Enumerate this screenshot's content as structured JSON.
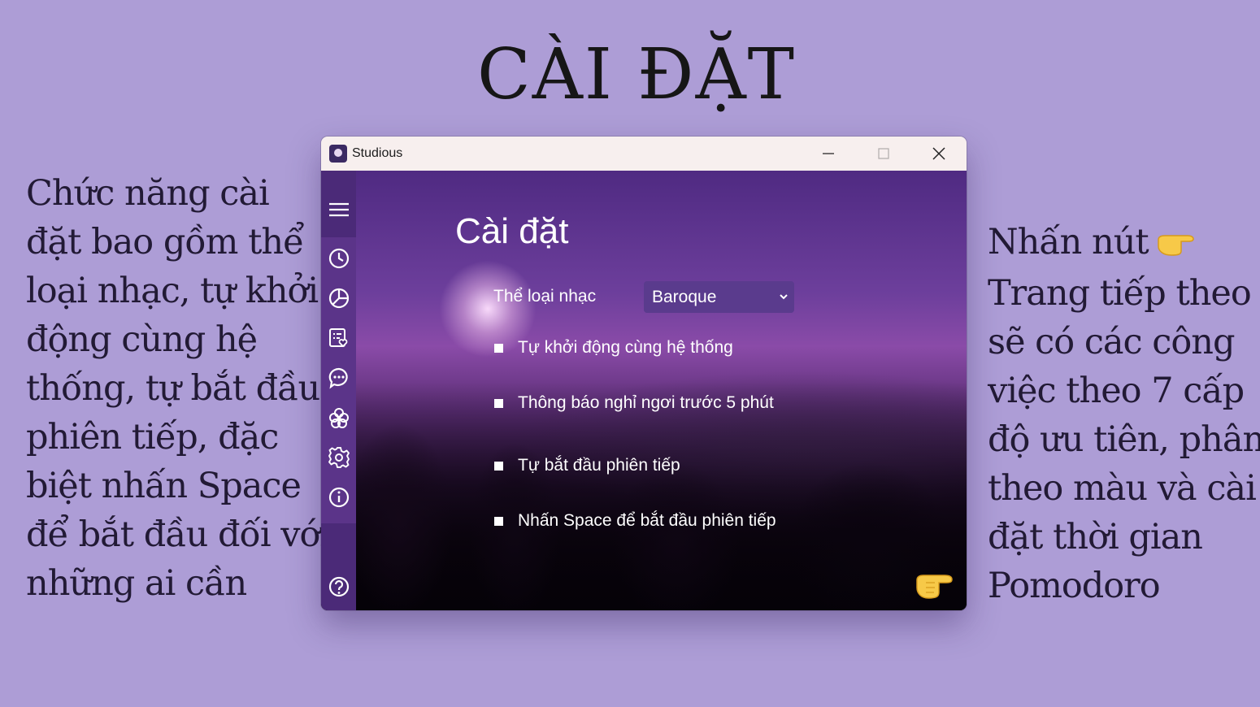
{
  "slide": {
    "title": "CÀI ĐẶT",
    "left_lines": [
      "Chức năng cài",
      "đặt bao gồm thể",
      "loại nhạc, tự khởi",
      "động cùng hệ",
      "thống, tự bắt đầu",
      "phiên tiếp, đặc",
      "biệt nhấn Space",
      "để bắt đầu đối với",
      "những ai cần"
    ],
    "right_lines": [
      "Nhấn nút",
      "Trang tiếp theo",
      "sẽ có các công",
      "việc theo 7 cấp",
      "độ ưu tiên, phân",
      "theo màu và cài",
      "đặt thời gian",
      "Pomodoro"
    ]
  },
  "window": {
    "app_name": "Studious",
    "heading": "Cài đặt",
    "music_label": "Thể loại nhạc",
    "music_selected": "Baroque",
    "options": [
      "Tự khởi động cùng hệ thống",
      "Thông báo nghỉ ngơi trước 5 phút",
      "Tự bắt đầu phiên tiếp",
      "Nhấn Space để bắt đầu phiên tiếp"
    ],
    "sidebar_icons": [
      "menu-icon",
      "clock-icon",
      "pie-chart-icon",
      "task-list-icon",
      "chat-icon",
      "flower-icon",
      "gear-icon",
      "info-icon",
      "help-icon"
    ]
  },
  "colors": {
    "slide_background": "#ad9dd6",
    "sidebar": "#4b2a78",
    "titlebar": "#f7efee",
    "select_background": "#5a3b8d"
  }
}
